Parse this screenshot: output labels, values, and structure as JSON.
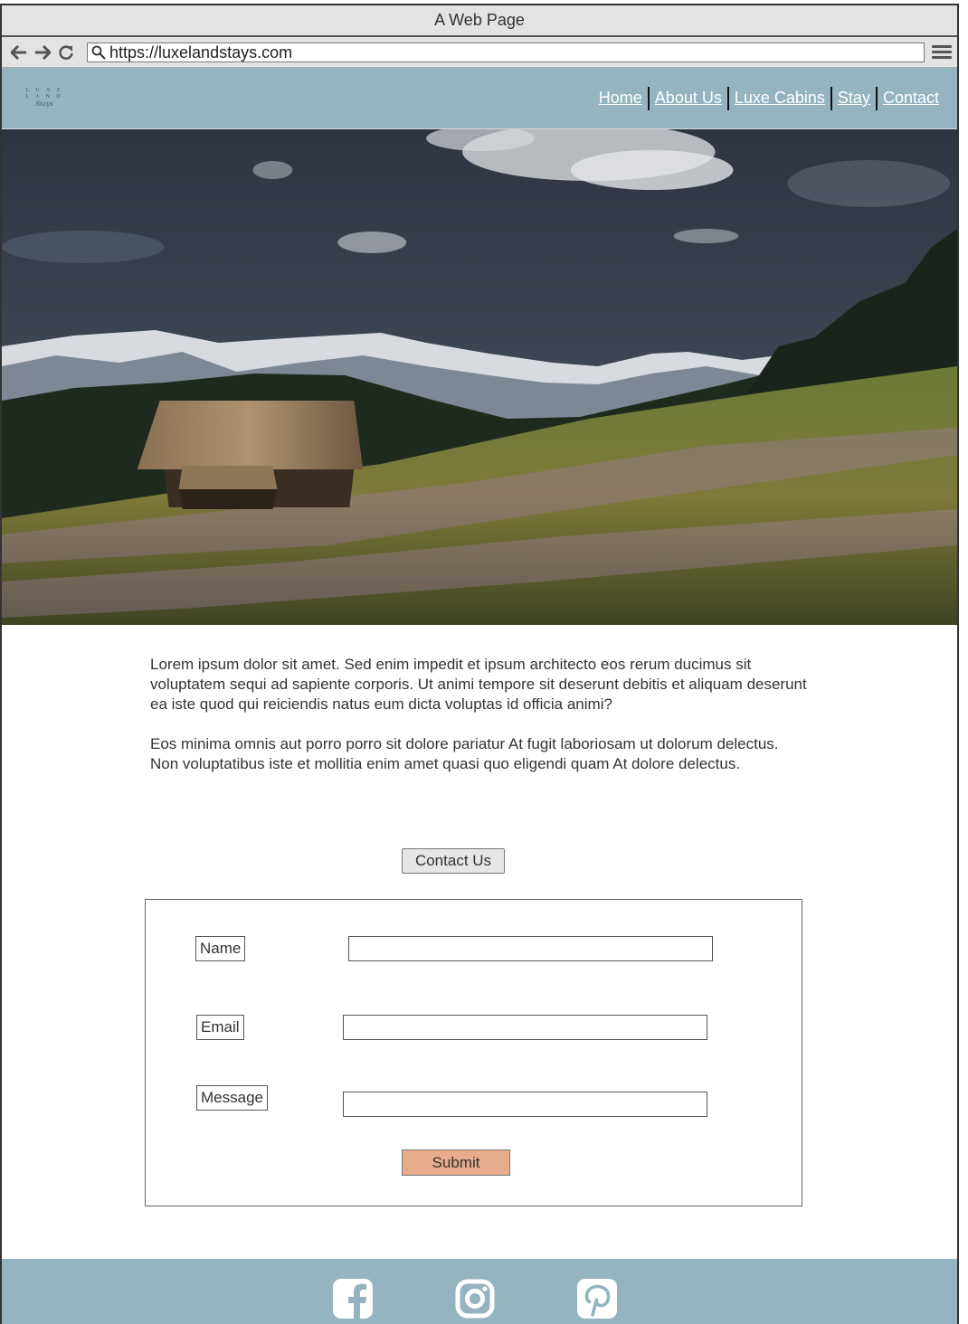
{
  "browser": {
    "title": "A Web Page",
    "url": "https://luxelandstays.com",
    "icons": [
      "back-icon",
      "forward-icon",
      "reload-icon",
      "search-icon",
      "menu-icon"
    ]
  },
  "header": {
    "logo": {
      "line1": "L U X E",
      "line2": "L A N D",
      "script": "Stays"
    },
    "nav": [
      "Home",
      "About Us",
      "Luxe Cabins",
      "Stay",
      "Contact"
    ]
  },
  "main": {
    "paragraphs": [
      "Lorem ipsum dolor sit amet. Sed enim impedit et ipsum architecto eos rerum ducimus sit voluptatem sequi ad sapiente corporis. Ut animi tempore sit deserunt debitis et aliquam deserunt ea iste quod qui reiciendis natus eum dicta voluptas id officia animi?",
      "Eos minima omnis aut porro porro sit dolore pariatur At fugit laboriosam ut dolorum delectus. Non voluptatibus iste et mollitia enim amet quasi quo eligendi quam At dolore delectus."
    ],
    "contact_button": "Contact Us"
  },
  "form": {
    "name_label": "Name",
    "email_label": "Email",
    "message_label": "Message",
    "name_value": "",
    "email_value": "",
    "message_value": "",
    "submit_label": "Submit"
  },
  "footer": {
    "icons": [
      "facebook-icon",
      "instagram-icon",
      "pinterest-icon"
    ]
  },
  "colors": {
    "header_bg": "#94b4bf",
    "submit_bg": "#e7ac8b",
    "chrome_bg": "#e3e3e3"
  }
}
